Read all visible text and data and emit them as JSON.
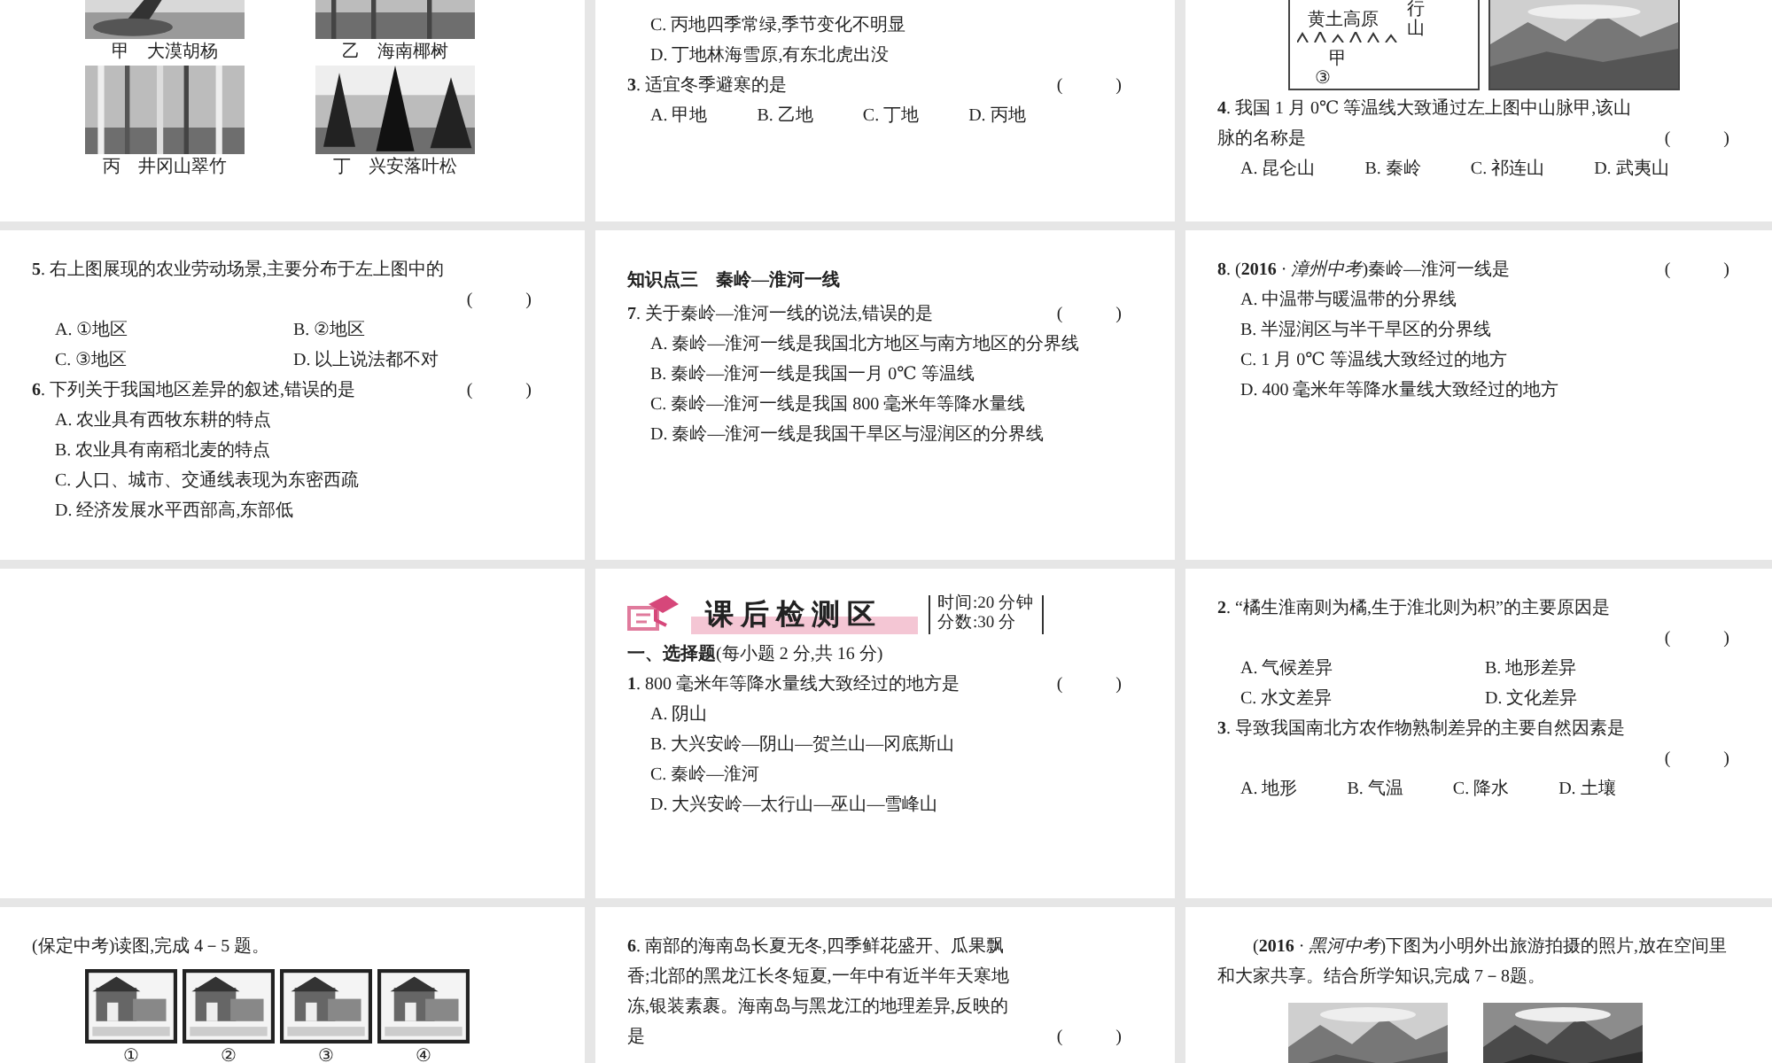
{
  "slides": [
    {
      "kind": "content",
      "blocks": [
        {
          "kind": "photo-grid",
          "items": [
            {
              "caption": "甲　大漠胡杨"
            },
            {
              "caption": "乙　海南椰树"
            },
            {
              "caption": "丙　井冈山翠竹"
            },
            {
              "caption": "丁　兴安落叶松"
            }
          ]
        }
      ]
    },
    {
      "kind": "content",
      "blocks": [
        {
          "kind": "option-line",
          "text": "C. 丙地四季常绿,季节变化不明显"
        },
        {
          "kind": "option-line",
          "text": "D. 丁地林海雪原,有东北虎出没"
        },
        {
          "kind": "question",
          "text": "**3**. 适宜冬季避寒的是",
          "paren": "(　　　)"
        },
        {
          "kind": "options-row",
          "items": [
            "A. 甲地",
            "B. 乙地",
            "C. 丁地",
            "D. 丙地"
          ]
        }
      ]
    },
    {
      "kind": "content",
      "blocks": [
        {
          "kind": "map-pair",
          "labels": [
            "行山",
            "黄土高原",
            "甲",
            "③"
          ]
        },
        {
          "kind": "question",
          "text": "**4**. 我国 1 月 0℃ 等温线大致通过左上图中山脉甲,该山脉的名称是",
          "paren": "(　　　)"
        },
        {
          "kind": "options-row",
          "items": [
            "A. 昆仑山",
            "B. 秦岭",
            "C. 祁连山",
            "D. 武夷山"
          ]
        }
      ]
    },
    {
      "kind": "content",
      "blocks": [
        {
          "kind": "question-long",
          "text": "**5**. 右上图展现的农业劳动场景,主要分布于左上图中的",
          "paren": "(　　　)"
        },
        {
          "kind": "options-pairs",
          "items": [
            "A. ①地区",
            "B. ②地区",
            "C. ③地区",
            "D. 以上说法都不对"
          ]
        },
        {
          "kind": "question",
          "text": "**6**. 下列关于我国地区差异的叙述,错误的是",
          "paren": "(　　　)"
        },
        {
          "kind": "options-stack",
          "items": [
            "A. 农业具有西牧东耕的特点",
            "B. 农业具有南稻北麦的特点",
            "C. 人口、城市、交通线表现为东密西疏",
            "D. 经济发展水平西部高,东部低"
          ]
        }
      ]
    },
    {
      "kind": "content",
      "blocks": [
        {
          "kind": "heading",
          "text": "知识点三　秦岭—淮河一线"
        },
        {
          "kind": "question",
          "text": "**7**. 关于秦岭—淮河一线的说法,错误的是",
          "paren": "(　　　)"
        },
        {
          "kind": "options-stack",
          "items": [
            "A. 秦岭—淮河一线是我国北方地区与南方地区的分界线",
            "B. 秦岭—淮河一线是我国一月 0℃ 等温线",
            "C. 秦岭—淮河一线是我国 800 毫米年等降水量线",
            "D. 秦岭—淮河一线是我国干旱区与湿润区的分界线"
          ]
        }
      ]
    },
    {
      "kind": "content",
      "blocks": [
        {
          "kind": "question",
          "text": "**8**. (**2016** · *漳州中考*)秦岭—淮河一线是",
          "paren": "(　　　)"
        },
        {
          "kind": "options-stack",
          "items": [
            "A. 中温带与暖温带的分界线",
            "B. 半湿润区与半干旱区的分界线",
            "C. 1 月 0℃ 等温线大致经过的地方",
            "D. 400 毫米年等降水量线大致经过的地方"
          ]
        }
      ]
    },
    {
      "kind": "empty"
    },
    {
      "kind": "content",
      "blocks": [
        {
          "kind": "banner",
          "title": "课后检测区",
          "info": [
            "时间:20 分钟",
            "分数:30 分"
          ]
        },
        {
          "kind": "paragraph",
          "text": "**一、选择题**(每小题 2 分,共 16 分)"
        },
        {
          "kind": "question",
          "text": "**1**. 800 毫米年等降水量线大致经过的地方是",
          "paren": "(　　　)"
        },
        {
          "kind": "options-stack",
          "items": [
            "A. 阴山",
            "B. 大兴安岭—阴山—贺兰山—冈底斯山",
            "C. 秦岭—淮河",
            "D. 大兴安岭—太行山—巫山—雪峰山"
          ]
        }
      ]
    },
    {
      "kind": "content",
      "blocks": [
        {
          "kind": "question-long",
          "text": "**2**. “橘生淮南则为橘,生于淮北则为枳”的主要原因是",
          "paren": "(　　　)"
        },
        {
          "kind": "options-pairs",
          "items": [
            "A. 气候差异",
            "B. 地形差异",
            "C. 水文差异",
            "D. 文化差异"
          ]
        },
        {
          "kind": "question-long",
          "text": "**3**. 导致我国南北方农作物熟制差异的主要自然因素是",
          "paren": "(　　　)"
        },
        {
          "kind": "options-row",
          "items": [
            "A. 地形",
            "B. 气温",
            "C. 降水",
            "D. 土壤"
          ]
        }
      ]
    },
    {
      "kind": "content",
      "blocks": [
        {
          "kind": "paragraph",
          "text": "(保定中考)读图,完成 4－5 题。"
        },
        {
          "kind": "stamps",
          "labels": [
            "①",
            "②",
            "③",
            "④"
          ]
        }
      ]
    },
    {
      "kind": "content",
      "blocks": [
        {
          "kind": "question",
          "text": "**6**. 南部的海南岛长夏无冬,四季鲜花盛开、瓜果飘香;北部的黑龙江长冬短夏,一年中有近半年天寒地冻,银装素裹。海南岛与黑龙江的地理差异,反映的是",
          "paren": "(　　　)"
        }
      ]
    },
    {
      "kind": "content",
      "blocks": [
        {
          "kind": "indented",
          "text": "(**2016** · *黑河中考*)下图为小明外出旅游拍摄的照片,放在空间里和大家共享。结合所学知识,完成 7－8题。"
        },
        {
          "kind": "photos"
        }
      ]
    }
  ]
}
